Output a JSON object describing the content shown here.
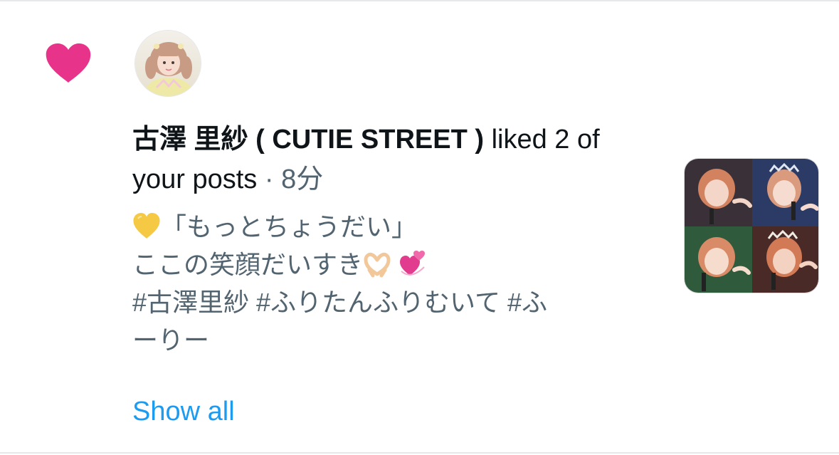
{
  "notification": {
    "type_icon": "heart-icon",
    "icon_color": "#e8338a",
    "avatar_icon": "profile-photo",
    "user_name": "古澤 里紗 ( CUTIE STREET )",
    "action_text": " liked 2 of your posts",
    "separator": " · ",
    "time": "8分",
    "post_lines": [
      "「もっとちょうだい」",
      "ここの笑顔だいすき",
      "#古澤里紗 #ふりたんふりむいて #ふ",
      "ーりー"
    ],
    "line1_emoji": "yellow-heart-icon",
    "line2_emojis": [
      "heart-hands-icon",
      "revolving-hearts-icon"
    ],
    "thumbnail": "post-thumbnail",
    "show_all_label": "Show all",
    "link_color": "#1d9bf0"
  }
}
